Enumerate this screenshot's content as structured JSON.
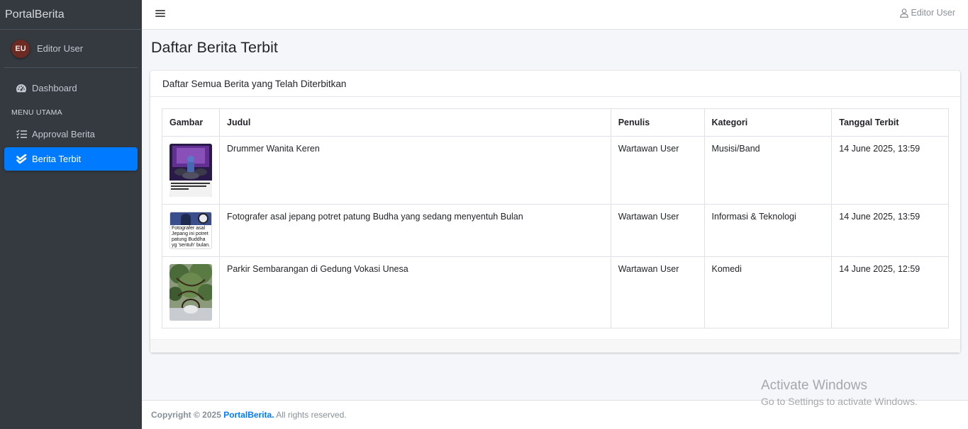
{
  "brand": "PortalBerita",
  "sidebar": {
    "user": {
      "initials": "EU",
      "name": "Editor User"
    },
    "items": [
      {
        "label": "Dashboard",
        "icon": "dashboard-icon"
      },
      {
        "label": "Approval Berita",
        "icon": "list-check-icon"
      },
      {
        "label": "Berita Terbit",
        "icon": "double-check-icon",
        "active": true
      }
    ],
    "section_header": "MENU UTAMA"
  },
  "topbar": {
    "user_label": "Editor User"
  },
  "page_title": "Daftar Berita Terbit",
  "card": {
    "header": "Daftar Semua Berita yang Telah Diterbitkan",
    "table": {
      "columns": [
        "Gambar",
        "Judul",
        "Penulis",
        "Kategori",
        "Tanggal Terbit"
      ],
      "rows": [
        {
          "judul": "Drummer Wanita Keren",
          "penulis": "Wartawan User",
          "kategori": "Musisi/Band",
          "tanggal": "14 June 2025, 13:59"
        },
        {
          "judul": "Fotografer asal jepang potret patung Budha yang sedang menyentuh Bulan",
          "penulis": "Wartawan User",
          "kategori": "Informasi & Teknologi",
          "tanggal": "14 June 2025, 13:59",
          "thumb_text": [
            "Fotografer asal",
            "Jepang ini potret",
            "patung Buddha",
            "yg 'sentuh' bulan."
          ]
        },
        {
          "judul": "Parkir Sembarangan di Gedung Vokasi Unesa",
          "penulis": "Wartawan User",
          "kategori": "Komedi",
          "tanggal": "14 June 2025, 12:59"
        }
      ]
    }
  },
  "footer": {
    "prefix": "Copyright © 2025 ",
    "brand": "PortalBerita.",
    "suffix": " All rights reserved."
  },
  "watermark": {
    "line1": "Activate Windows",
    "line2": "Go to Settings to activate Windows."
  },
  "colors": {
    "sidebar_bg": "#343a40",
    "accent": "#007bff",
    "content_bg": "#f4f6f9"
  }
}
